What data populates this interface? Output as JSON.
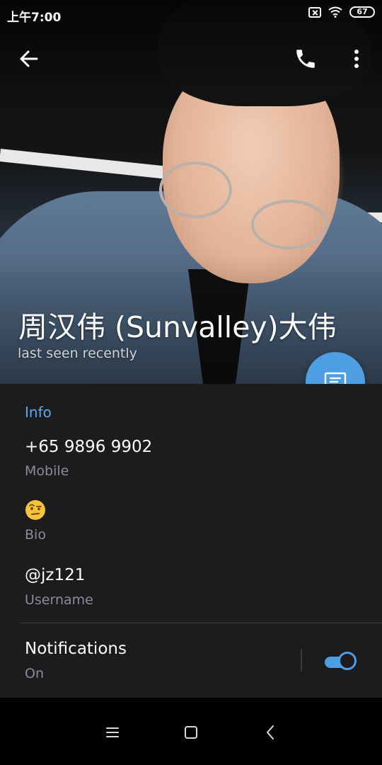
{
  "status_bar": {
    "time": "上午7:00",
    "battery": "67"
  },
  "profile": {
    "name": "周汉伟 (Sunvalley)大伟",
    "status": "last seen recently"
  },
  "info": {
    "heading": "Info",
    "phone": {
      "value": "+65 9896 9902",
      "label": "Mobile"
    },
    "bio": {
      "value": "🤨",
      "label": "Bio"
    },
    "username": {
      "value": "@jz121",
      "label": "Username"
    }
  },
  "notifications": {
    "label": "Notifications",
    "state": "On",
    "enabled": true
  },
  "colors": {
    "accent": "#4d9ee3",
    "background": "#1c1c1e",
    "secondary_text": "#8a8d91"
  }
}
